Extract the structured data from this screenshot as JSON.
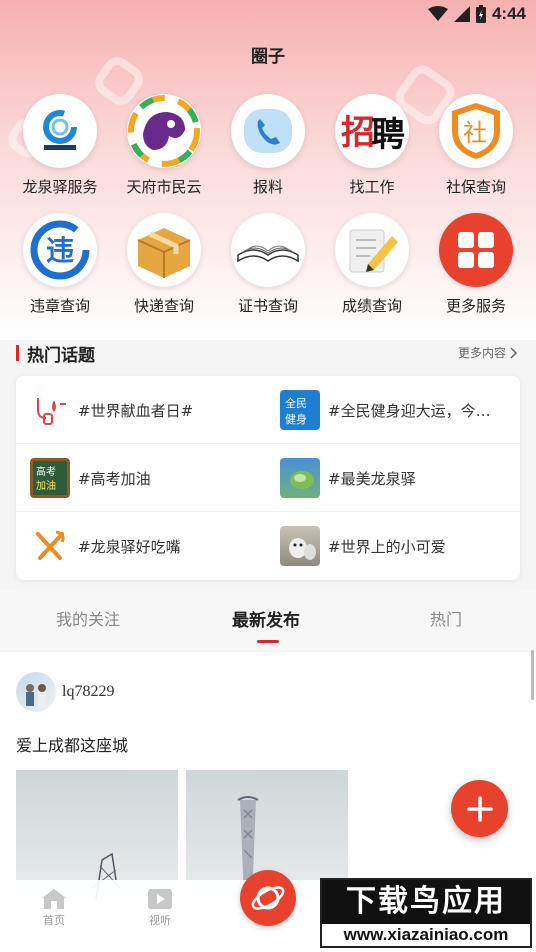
{
  "status": {
    "time": "4:44"
  },
  "page": {
    "title": "圈子"
  },
  "services_row1": [
    {
      "label": "龙泉驿服务",
      "icon": "longquan-logo-icon"
    },
    {
      "label": "天府市民云",
      "icon": "tianfu-app-icon"
    },
    {
      "label": "报料",
      "icon": "phone-icon"
    },
    {
      "label": "找工作",
      "icon": "recruit-icon"
    },
    {
      "label": "社保查询",
      "icon": "social-security-icon"
    }
  ],
  "services_row2": [
    {
      "label": "违章查询",
      "icon": "violation-icon"
    },
    {
      "label": "快递查询",
      "icon": "package-icon"
    },
    {
      "label": "证书查询",
      "icon": "book-icon"
    },
    {
      "label": "成绩查询",
      "icon": "pencil-icon"
    },
    {
      "label": "更多服务",
      "icon": "grid-icon"
    }
  ],
  "topics": {
    "title": "热门话题",
    "more": "更多内容",
    "items": [
      {
        "text": "#世界献血者日#",
        "icon": "blood-donation-icon"
      },
      {
        "text": "#全民健身迎大运，今…",
        "icon": "fitness-badge-icon",
        "badge": "全民\n健身"
      },
      {
        "text": "#高考加油",
        "icon": "chalkboard-icon",
        "badge": "高考\n加油"
      },
      {
        "text": "#最美龙泉驿",
        "icon": "landscape-icon"
      },
      {
        "text": "#龙泉驿好吃嘴",
        "icon": "cutlery-icon"
      },
      {
        "text": "#世界上的小可爱",
        "icon": "pet-photo-icon"
      }
    ]
  },
  "feed_tabs": [
    {
      "label": "我的关注"
    },
    {
      "label": "最新发布"
    },
    {
      "label": "热门"
    }
  ],
  "post": {
    "username": "lq78229",
    "text": "爱上成都这座城"
  },
  "nav": [
    {
      "label": "首页"
    },
    {
      "label": "视听"
    }
  ],
  "watermark": {
    "top": "下载鸟应用",
    "bottom": "www.xiazainiao.com"
  },
  "colors": {
    "accent": "#d9282c",
    "fab": "#e8422f"
  }
}
